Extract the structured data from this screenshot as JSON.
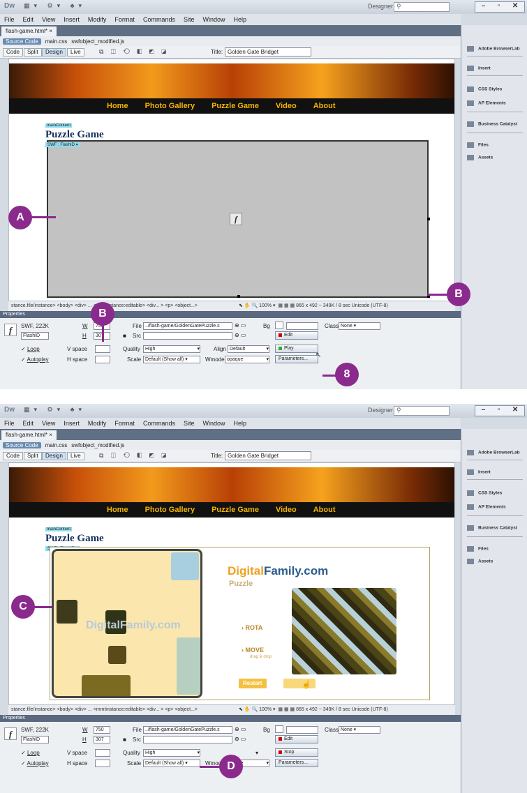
{
  "app": {
    "logo": "Dw",
    "workspace": "Designer",
    "menu": [
      "File",
      "Edit",
      "View",
      "Insert",
      "Modify",
      "Format",
      "Commands",
      "Site",
      "Window",
      "Help"
    ],
    "doc_tab1": "flash-game.html*",
    "doc_tab2": "flash-game.html*",
    "source_code": "Source Code",
    "related_files": [
      "main.css",
      "swfobject_modified.js"
    ],
    "views": [
      "Code",
      "Split",
      "Design",
      "Live"
    ],
    "title_label": "Title:",
    "title_value": "Golden Gate Bridget"
  },
  "page": {
    "nav": [
      "Home",
      "Photo Gallery",
      "Puzzle Game",
      "Video",
      "About"
    ],
    "main_content_label": "mainContent",
    "heading": "Puzzle Game",
    "swf_label": "SWF : FlashID"
  },
  "tagbar": {
    "path1": "stance.file/instance> <body> <div> ... <mmtinstance:editable> <div... > <p> <object...>",
    "path2": "stance.file/instance> <body> <div> ... <mmtinstance:editable> <div... > <p> <object...>",
    "zoom": "100%",
    "size_info": "865 x 492 ~ 349K / 8 sec Unicode (UTF-8)"
  },
  "properties": {
    "header": "Properties",
    "swf_size": "SWF, 222K",
    "w_label": "W",
    "w_value": "750",
    "h_label": "H",
    "h_value": "307",
    "id_value": "FlashID",
    "file_label": "File",
    "file_value": "../flash-game/GoldenGatePuzzle.s",
    "src_label": "Src",
    "bg_label": "Bg",
    "edit_label": "Edit",
    "class_label": "Class",
    "class_value": "None",
    "loop": "Loop",
    "autoplay": "Autoplay",
    "vspace": "V space",
    "hspace": "H space",
    "quality_label": "Quality",
    "quality_value": "High",
    "scale_label": "Scale",
    "scale_value": "Default (Show all)",
    "align_label": "Align",
    "align_value": "Default",
    "wmode_label": "Wmode",
    "wmode_value": "opaque",
    "play_label": "Play",
    "stop_label": "Stop",
    "parameters_label": "Parameters..."
  },
  "panels": [
    "Adobe BrowserLab",
    "Insert",
    "CSS Styles",
    "AP Elements",
    "Business Catalyst",
    "Files",
    "Assets"
  ],
  "puzzle": {
    "logo_digital": "Digital",
    "logo_family": "Family.com",
    "puzzle_word": "Puzzle",
    "rota": "ROTA",
    "move": "MOVE",
    "move_sub": "drag & drop",
    "restart": "Restart",
    "ghost_logo": "DigitalFamily.com"
  },
  "callouts": {
    "a": "A",
    "b": "B",
    "b2": "B",
    "eight": "8",
    "c": "C",
    "d": "D"
  },
  "colors": {
    "callout": "#8b2a8d",
    "nav_text": "#f4b400",
    "heading": "#16315f"
  }
}
